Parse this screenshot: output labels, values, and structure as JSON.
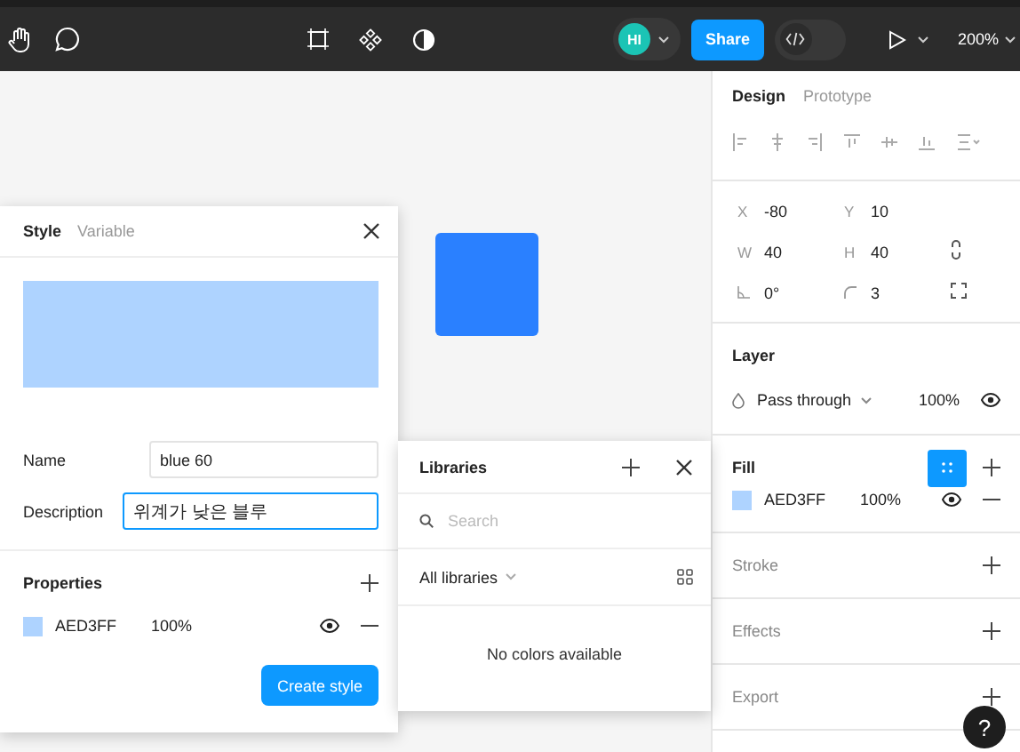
{
  "toolbar": {
    "avatar": "HI",
    "share": "Share",
    "dev_mode_on": false,
    "zoom": "200%"
  },
  "panel": {
    "tabs": [
      {
        "label": "Design",
        "selected": true
      },
      {
        "label": "Prototype",
        "selected": false
      }
    ],
    "position": [
      {
        "kind": "letter",
        "label": "X",
        "value": "-80"
      },
      {
        "kind": "letter",
        "label": "Y",
        "value": "10"
      },
      {
        "kind": "letter",
        "label": "W",
        "value": "40"
      },
      {
        "kind": "letter",
        "label": "H",
        "value": "40"
      },
      {
        "kind": "rotation",
        "value": "0°"
      },
      {
        "kind": "radius",
        "value": "3"
      }
    ],
    "layer": {
      "title": "Layer",
      "blend": "Pass through",
      "opacity": "100%"
    },
    "fill": {
      "title": "Fill",
      "color": "#aed3ff",
      "hex": "AED3FF",
      "opacity": "100%"
    },
    "sections": [
      "Stroke",
      "Effects",
      "Export"
    ],
    "help": "?"
  },
  "style_dialog": {
    "tabs": [
      {
        "label": "Style",
        "selected": true
      },
      {
        "label": "Variable",
        "selected": false
      }
    ],
    "name_label": "Name",
    "name": "blue 60",
    "description_label": "Description",
    "description": "위계가 낮은 블루",
    "properties_title": "Properties",
    "color": "#aed3ff",
    "hex": "AED3FF",
    "opacity": "100%",
    "button": "Create style"
  },
  "libraries": {
    "title": "Libraries",
    "search_placeholder": "Search",
    "filter": "All libraries",
    "empty": "No colors available"
  }
}
